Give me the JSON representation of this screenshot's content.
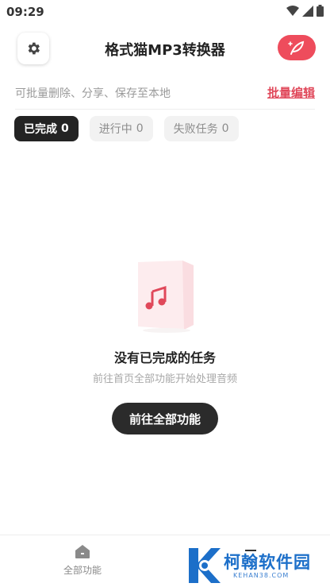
{
  "status_bar": {
    "time": "09:29"
  },
  "header": {
    "title": "格式猫MP3转换器"
  },
  "hint_row": {
    "hint": "可批量删除、分享、保存至本地",
    "batch_edit": "批量编辑"
  },
  "tabs": [
    {
      "label": "已完成",
      "count": "0",
      "active": true
    },
    {
      "label": "进行中",
      "count": "0",
      "active": false
    },
    {
      "label": "失败任务",
      "count": "0",
      "active": false
    }
  ],
  "empty_state": {
    "title": "没有已完成的任务",
    "subtitle": "前往首页全部功能开始处理音频",
    "button": "前往全部功能",
    "icon": "music-note-icon"
  },
  "bottom_nav": [
    {
      "label": "全部功能",
      "icon": "home-icon"
    },
    {
      "label": "",
      "icon": "tasks-icon"
    }
  ],
  "watermark": {
    "text": "柯翰软件园",
    "sub": "KEHAN38.COM"
  },
  "colors": {
    "accent": "#ee4c5c",
    "dark": "#232323",
    "link": "#e0485a",
    "watermark": "#1c6fc9"
  }
}
